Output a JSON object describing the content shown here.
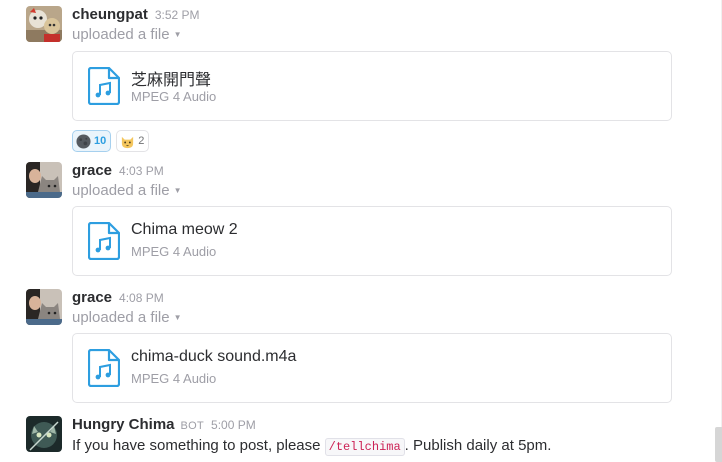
{
  "messages": [
    {
      "author": "cheungpat",
      "time": "3:52 PM",
      "action": "uploaded a file",
      "file": {
        "title": "芝麻開門聲",
        "type": "MPEG 4 Audio",
        "icon": "audio-file-icon"
      },
      "reactions": [
        {
          "emoji": "dark-moon-face-emoji",
          "count": "10",
          "active": true
        },
        {
          "emoji": "cat-face-emoji",
          "count": "2",
          "active": false
        }
      ]
    },
    {
      "author": "grace",
      "time": "4:03 PM",
      "action": "uploaded a file",
      "file": {
        "title": "Chima meow 2",
        "type": "MPEG 4 Audio",
        "icon": "audio-file-icon"
      }
    },
    {
      "author": "grace",
      "time": "4:08 PM",
      "action": "uploaded a file",
      "file": {
        "title": "chima-duck sound.m4a",
        "type": "MPEG 4 Audio",
        "icon": "audio-file-icon"
      }
    },
    {
      "author": "Hungry Chima",
      "badge": "BOT",
      "time": "5:00 PM",
      "text_before": "If you have something to post, please ",
      "command": "/tellchima",
      "text_after": ". Publish daily at 5pm."
    }
  ],
  "colors": {
    "accent": "#2d9ee0",
    "file_icon": "#2d9ee0",
    "muted_text": "#9e9ea6",
    "code_text": "#cc2255"
  }
}
